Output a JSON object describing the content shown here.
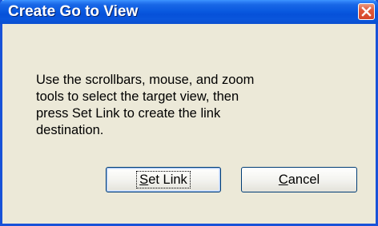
{
  "window": {
    "title": "Create Go to View",
    "close_symbol": "×"
  },
  "message": "Use the scrollbars, mouse, and zoom\ntools to select the target view, then\npress Set Link to create the link\ndestination.",
  "buttons": {
    "set_link": {
      "mnemonic": "S",
      "rest": "et Link"
    },
    "cancel": {
      "mnemonic": "C",
      "rest": "ancel"
    }
  },
  "colors": {
    "titlebar": "#0a5ae0",
    "window_bg": "#ece9d8",
    "close_button": "#e0583a"
  },
  "icons": {
    "close": "close-icon"
  }
}
